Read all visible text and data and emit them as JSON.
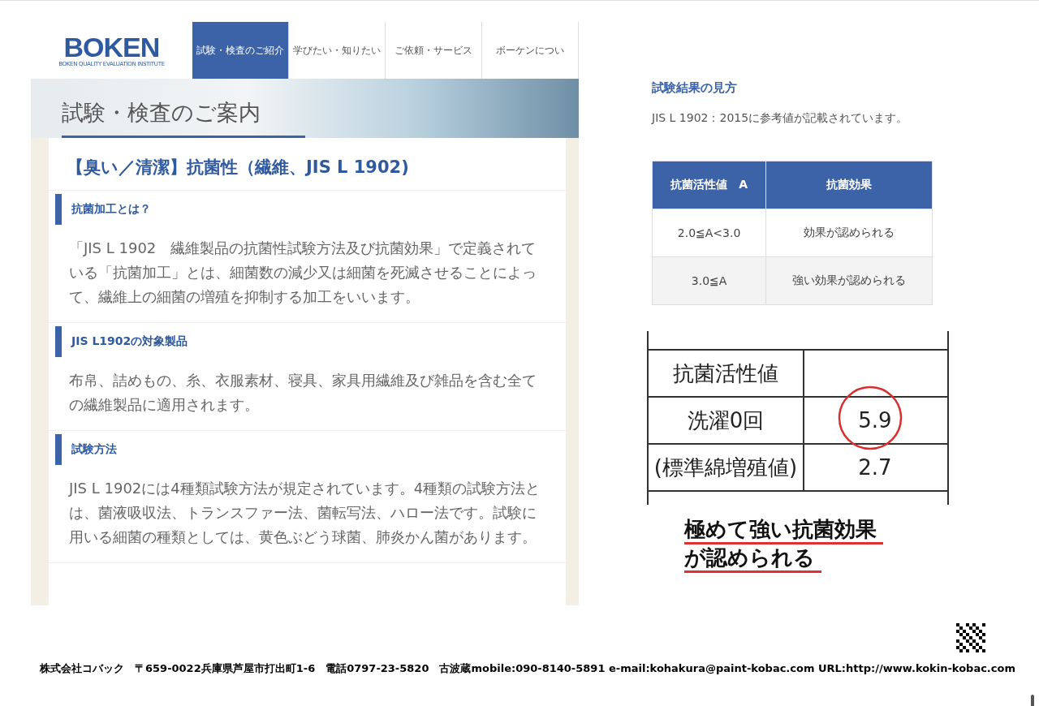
{
  "logo": {
    "text": "BOKEN",
    "subtitle": "BOKEN QUALITY EVALUATION INSTITUTE"
  },
  "nav": [
    {
      "label": "試験・検査のご紹介",
      "selected": true
    },
    {
      "label": "学びたい・知りたい",
      "selected": false
    },
    {
      "label": "ご依頼・サービス",
      "selected": false
    },
    {
      "label": "ボーケンについ",
      "selected": false
    }
  ],
  "banner": {
    "title": "試験・検査のご案内"
  },
  "article": {
    "title": "【臭い／清潔】抗菌性（繊維、JIS L 1902)",
    "sections": [
      {
        "heading": "抗菌加工とは？",
        "body": "「JIS L 1902　繊維製品の抗菌性試験方法及び抗菌効果」で定義されている「抗菌加工」とは、細菌数の減少又は細菌を死滅させることによって、繊維上の細菌の増殖を抑制する加工をいいます。"
      },
      {
        "heading": "JIS L1902の対象製品",
        "body": "布帛、詰めもの、糸、衣服素材、寝具、家具用繊維及び雑品を含む全ての繊維製品に適用されます。"
      },
      {
        "heading": "試験方法",
        "body": "JIS L 1902には4種類試験方法が規定されています。4種類の試験方法とは、菌液吸収法、トランスファー法、菌転写法、ハロー法です。試験に用いる細菌の種類としては、黄色ぶどう球菌、肺炎かん菌があります。"
      }
    ]
  },
  "results": {
    "heading": "試験結果の見方",
    "note": "JIS L 1902：2015に参考値が記載されています。",
    "table": {
      "columns": [
        "抗菌活性値　A",
        "抗菌効果"
      ],
      "rows": [
        [
          "2.0≦A<3.0",
          "効果が認められる"
        ],
        [
          "3.0≦A",
          "強い効果が認められる"
        ]
      ]
    }
  },
  "scan_table": {
    "rows": [
      {
        "label": "抗菌活性値",
        "circled": false
      },
      {
        "label": "洗濯0回",
        "value": "5.9",
        "circled": true
      },
      {
        "label": "(標準綿増殖値)",
        "value": "2.7",
        "circled": false
      }
    ]
  },
  "conclusion": [
    "極めて強い抗菌効果",
    "が認められる"
  ],
  "footer": "株式会社コバック　〒659-0022兵庫県芦屋市打出町1-6　電話0797-23-5820　古波蔵mobile:090-8140-5891 e-mail:kohakura@paint-kobac.com URL:http://www.kokin-kobac.com"
}
